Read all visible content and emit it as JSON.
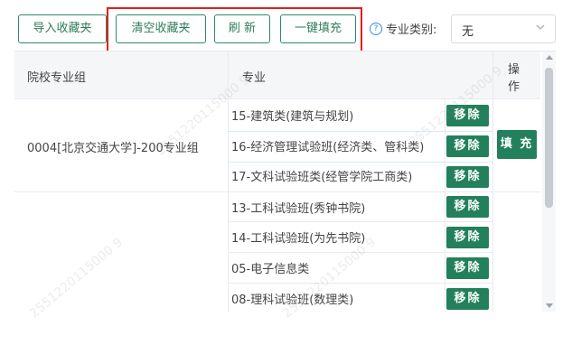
{
  "toolbar": {
    "import_label": "导入收藏夹",
    "clear_label": "清空收藏夹",
    "refresh_label": "刷 新",
    "autofill_label": "一键填充",
    "help_icon": "?",
    "category_label": "专业类别:",
    "category_value": "无"
  },
  "table": {
    "headers": {
      "school": "院校专业组",
      "major": "专业",
      "action_line1": "操",
      "action_line2": "作"
    },
    "groups": [
      {
        "school": "0004[北京交通大学]-200专业组",
        "fill_label": "填 充",
        "majors": [
          {
            "name": "15-建筑类(建筑与规划)",
            "remove": "移除"
          },
          {
            "name": "16-经济管理试验班(经济类、管科类)",
            "remove": "移除"
          },
          {
            "name": "17-文科试验班类(经管学院工商类)",
            "remove": "移除"
          }
        ]
      },
      {
        "school": "",
        "majors": [
          {
            "name": "13-工科试验班(秀钟书院)",
            "remove": "移除"
          },
          {
            "name": "14-工科试验班(为先书院)",
            "remove": "移除"
          },
          {
            "name": "05-电子信息类",
            "remove": "移除"
          },
          {
            "name": "08-理科试验班(数理类)",
            "remove": "移除"
          }
        ]
      }
    ]
  },
  "watermark": "2551220115000 9"
}
